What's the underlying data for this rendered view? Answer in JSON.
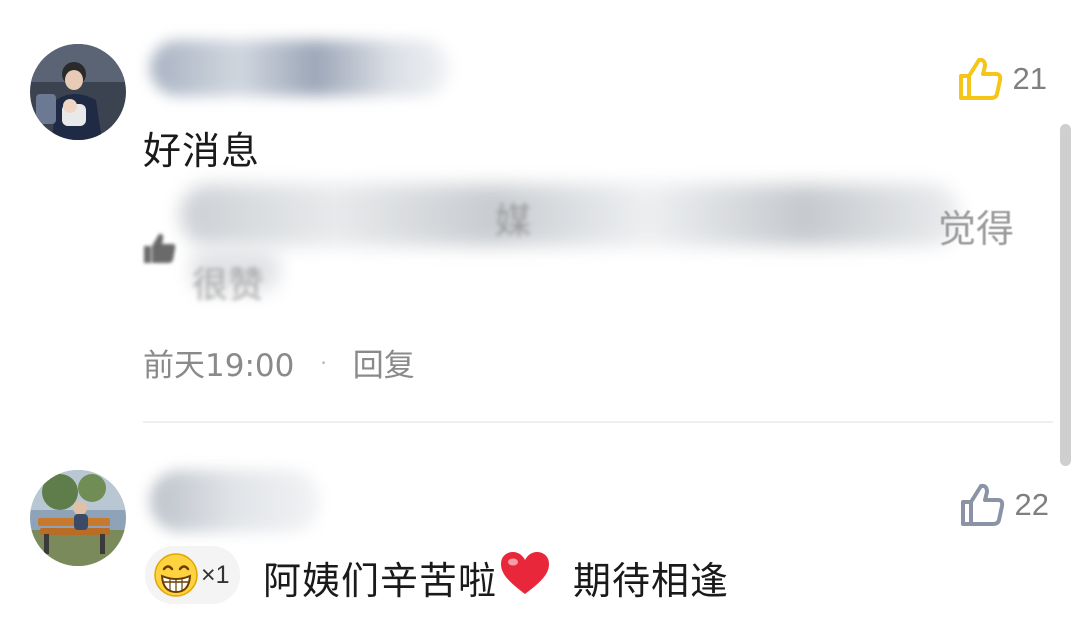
{
  "comments": [
    {
      "text": "好消息",
      "likes": "21",
      "reply": {
        "visible_fragment_a": "媒",
        "visible_fragment_b": "觉得",
        "visible_fragment_c": "很赞"
      },
      "time": "前天19:00",
      "reply_label": "回复",
      "separator": "·",
      "like_icon_color": "#F5C518"
    },
    {
      "text": "阿姨们辛苦啦",
      "text_after": "期待相逢",
      "likes": "22",
      "emoji_count": "×1",
      "like_icon_color": "#8A94A6"
    }
  ],
  "icons": {
    "like": "thumbs-up-icon",
    "heart": "heart-icon",
    "grin": "grinning-emoji-icon",
    "reply_like": "small-thumbs-up-icon"
  }
}
